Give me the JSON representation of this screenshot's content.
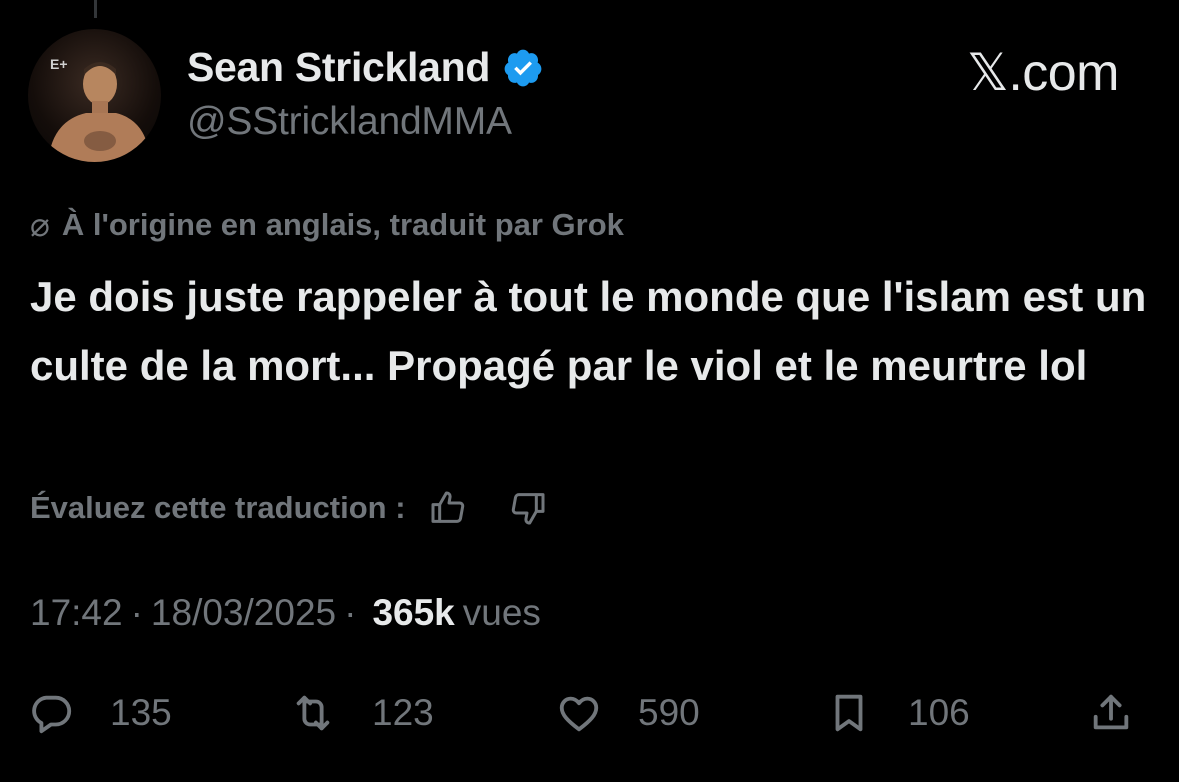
{
  "post": {
    "author": {
      "display_name": "Sean Strickland",
      "handle": "@SStricklandMMA",
      "verified": true,
      "avatar_logo_text": "E+"
    },
    "brand": "𝕏.com",
    "translation": {
      "icon": "⌀",
      "note": "À l'origine en anglais, traduit par Grok",
      "rate_label": "Évaluez cette traduction :"
    },
    "text": "Je dois juste rappeler à tout le monde que l'islam est un culte de la mort... Propagé par le viol et le meurtre lol",
    "meta": {
      "time": "17:42",
      "sep1": "·",
      "date": "18/03/2025",
      "sep2": "·",
      "views_count": "365k",
      "views_label": "vues"
    },
    "actions": {
      "replies": "135",
      "reposts": "123",
      "likes": "590",
      "bookmarks": "106"
    }
  },
  "colors": {
    "background": "#000000",
    "text": "#e7e9ea",
    "muted": "#71767b",
    "verified": "#1d9bf0"
  },
  "icons": [
    "verified-badge-icon",
    "translate-icon",
    "thumbs-up-icon",
    "thumbs-down-icon",
    "reply-icon",
    "repost-icon",
    "like-icon",
    "bookmark-icon",
    "share-icon"
  ]
}
